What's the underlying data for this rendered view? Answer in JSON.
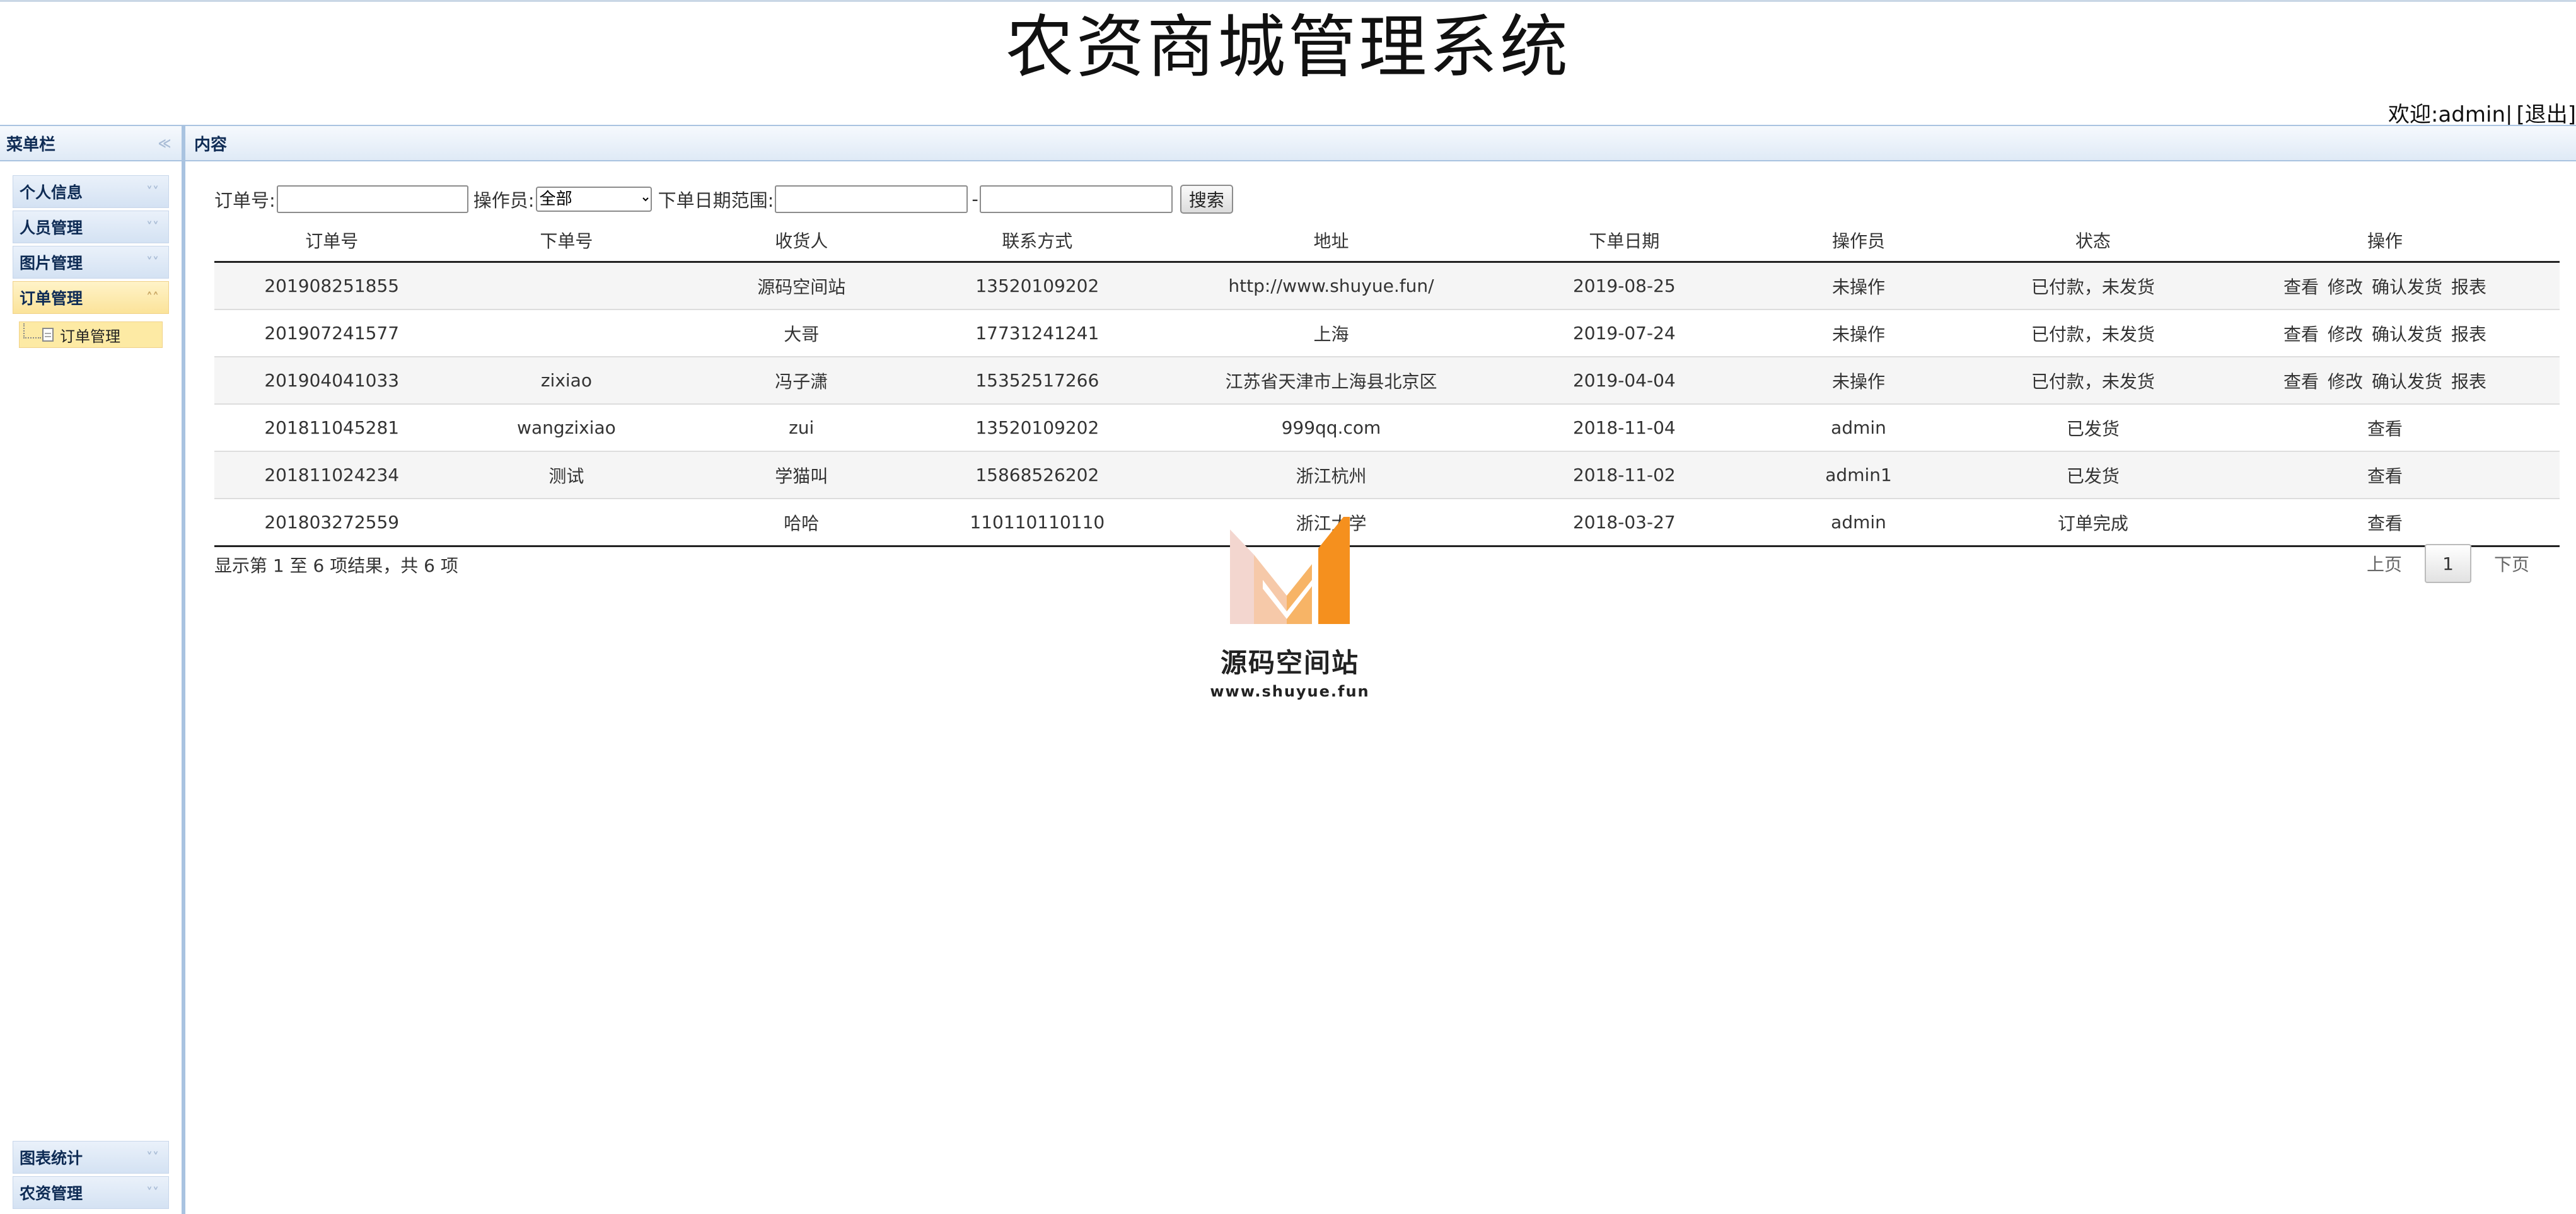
{
  "app": {
    "title": "农资商城管理系统",
    "welcome": "欢迎:admin|",
    "logout": "[退出]"
  },
  "sidebar": {
    "header": "菜单栏",
    "groups": [
      {
        "label": "个人信息",
        "expanded": false
      },
      {
        "label": "人员管理",
        "expanded": false
      },
      {
        "label": "图片管理",
        "expanded": false
      },
      {
        "label": "订单管理",
        "expanded": true,
        "items": [
          {
            "label": "订单管理"
          }
        ]
      }
    ],
    "bottom_groups": [
      {
        "label": "图表统计"
      },
      {
        "label": "农资管理"
      }
    ]
  },
  "content": {
    "header": "内容"
  },
  "search": {
    "order_no_label": "订单号:",
    "operator_label": "操作员:",
    "operator_selected": "全部",
    "date_range_label": "下单日期范围:",
    "date_separator": "-",
    "search_button": "搜索"
  },
  "table": {
    "columns": [
      "订单号",
      "下单号",
      "收货人",
      "联系方式",
      "地址",
      "下单日期",
      "操作员",
      "状态",
      "操作"
    ],
    "rows": [
      {
        "order_no": "201908251855",
        "place_no": "",
        "receiver": "源码空间站",
        "contact": "13520109202",
        "address": "http://www.shuyue.fun/",
        "date": "2019-08-25",
        "operator": "未操作",
        "status": "已付款，未发货",
        "actions": [
          "查看",
          "修改",
          "确认发货",
          "报表"
        ]
      },
      {
        "order_no": "201907241577",
        "place_no": "",
        "receiver": "大哥",
        "contact": "17731241241",
        "address": "上海",
        "date": "2019-07-24",
        "operator": "未操作",
        "status": "已付款，未发货",
        "actions": [
          "查看",
          "修改",
          "确认发货",
          "报表"
        ]
      },
      {
        "order_no": "201904041033",
        "place_no": "zixiao",
        "receiver": "冯子潇",
        "contact": "15352517266",
        "address": "江苏省天津市上海县北京区",
        "date": "2019-04-04",
        "operator": "未操作",
        "status": "已付款，未发货",
        "actions": [
          "查看",
          "修改",
          "确认发货",
          "报表"
        ]
      },
      {
        "order_no": "201811045281",
        "place_no": "wangzixiao",
        "receiver": "zui",
        "contact": "13520109202",
        "address": "999qq.com",
        "date": "2018-11-04",
        "operator": "admin",
        "status": "已发货",
        "actions": [
          "查看"
        ]
      },
      {
        "order_no": "201811024234",
        "place_no": "测试",
        "receiver": "学猫叫",
        "contact": "15868526202",
        "address": "浙江杭州",
        "date": "2018-11-02",
        "operator": "admin1",
        "status": "已发货",
        "actions": [
          "查看"
        ]
      },
      {
        "order_no": "201803272559",
        "place_no": "",
        "receiver": "哈哈",
        "contact": "110110110110",
        "address": "浙江大学",
        "date": "2018-03-27",
        "operator": "admin",
        "status": "订单完成",
        "actions": [
          "查看"
        ]
      }
    ]
  },
  "footer": {
    "result_info": "显示第 1 至 6 项结果，共 6 项",
    "prev": "上页",
    "current_page": "1",
    "next": "下页"
  },
  "watermark": {
    "name": "源码空间站",
    "url": "www.shuyue.fun",
    "colors": {
      "pale": "#f3d6cf",
      "orange": "#f5901e",
      "light_orange": "#f7b466"
    }
  }
}
